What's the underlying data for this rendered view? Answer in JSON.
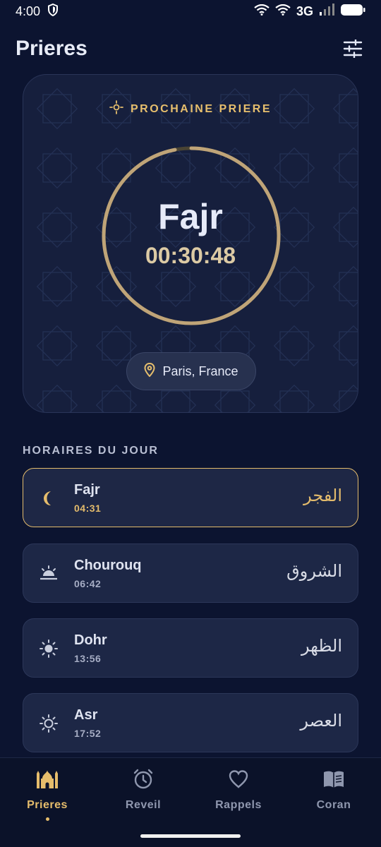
{
  "status_bar": {
    "time": "4:00",
    "network": "3G"
  },
  "app_bar": {
    "title": "Prieres"
  },
  "next_prayer": {
    "label": "PROCHAINE PRIERE",
    "name": "Fajr",
    "countdown": "00:30:48",
    "progress": 0.97,
    "location": "Paris, France"
  },
  "schedule": {
    "title": "HORAIRES DU JOUR",
    "items": [
      {
        "name": "Fajr",
        "time": "04:31",
        "arabic": "الفجر",
        "icon": "moon-icon",
        "active": true
      },
      {
        "name": "Chourouq",
        "time": "06:42",
        "arabic": "الشروق",
        "icon": "sunrise-icon",
        "active": false
      },
      {
        "name": "Dohr",
        "time": "13:56",
        "arabic": "الظهر",
        "icon": "sun-icon",
        "active": false
      },
      {
        "name": "Asr",
        "time": "17:52",
        "arabic": "العصر",
        "icon": "sun-outline-icon",
        "active": false
      }
    ]
  },
  "nav": {
    "items": [
      {
        "label": "Prieres",
        "icon": "mosque-icon",
        "active": true
      },
      {
        "label": "Reveil",
        "icon": "alarm-icon",
        "active": false
      },
      {
        "label": "Rappels",
        "icon": "heart-icon",
        "active": false
      },
      {
        "label": "Coran",
        "icon": "book-icon",
        "active": false
      }
    ]
  },
  "colors": {
    "accent": "#e3bb6c",
    "background": "#0c1430",
    "card": "#1d2746"
  }
}
